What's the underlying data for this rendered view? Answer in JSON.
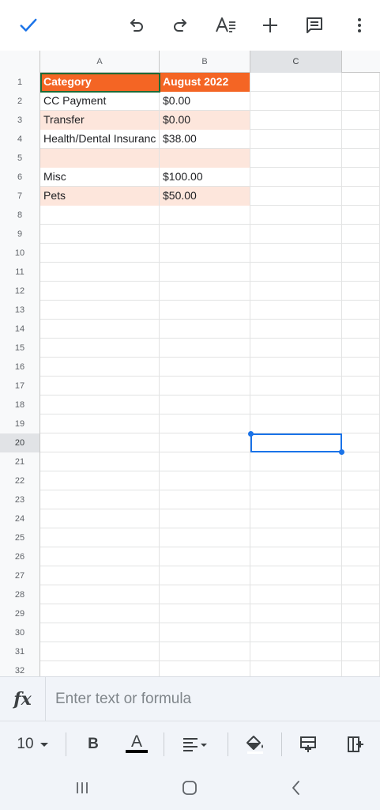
{
  "toolbar": {
    "done_icon": "check-icon",
    "undo_icon": "undo-icon",
    "redo_icon": "redo-icon",
    "text_format_icon": "text-format-icon",
    "insert_icon": "plus-icon",
    "comment_icon": "comment-icon",
    "more_icon": "more-vert-icon",
    "accent": "#1a73e8"
  },
  "columns": [
    "A",
    "B",
    "C"
  ],
  "rows": [
    {
      "num": "1",
      "a": "Category",
      "b": "August 2022",
      "style": "header"
    },
    {
      "num": "2",
      "a": "CC Payment",
      "b": "$0.00",
      "style": "plain"
    },
    {
      "num": "3",
      "a": "Transfer",
      "b": "$0.00",
      "style": "band"
    },
    {
      "num": "4",
      "a": "Health/Dental Insuranc",
      "b": "$38.00",
      "style": "plain"
    },
    {
      "num": "5",
      "a": "",
      "b": "",
      "style": "band"
    },
    {
      "num": "6",
      "a": "Misc",
      "b": "$100.00",
      "style": "plain"
    },
    {
      "num": "7",
      "a": "Pets",
      "b": "$50.00",
      "style": "band"
    },
    {
      "num": "8",
      "a": "",
      "b": "",
      "style": "empty"
    },
    {
      "num": "9",
      "a": "",
      "b": "",
      "style": "empty"
    },
    {
      "num": "10",
      "a": "",
      "b": "",
      "style": "empty"
    },
    {
      "num": "11",
      "a": "",
      "b": "",
      "style": "empty"
    },
    {
      "num": "12",
      "a": "",
      "b": "",
      "style": "empty"
    },
    {
      "num": "13",
      "a": "",
      "b": "",
      "style": "empty"
    },
    {
      "num": "14",
      "a": "",
      "b": "",
      "style": "empty"
    },
    {
      "num": "15",
      "a": "",
      "b": "",
      "style": "empty"
    },
    {
      "num": "16",
      "a": "",
      "b": "",
      "style": "empty"
    },
    {
      "num": "17",
      "a": "",
      "b": "",
      "style": "empty"
    },
    {
      "num": "18",
      "a": "",
      "b": "",
      "style": "empty"
    },
    {
      "num": "19",
      "a": "",
      "b": "",
      "style": "empty"
    },
    {
      "num": "20",
      "a": "",
      "b": "",
      "style": "empty"
    },
    {
      "num": "21",
      "a": "",
      "b": "",
      "style": "empty"
    },
    {
      "num": "22",
      "a": "",
      "b": "",
      "style": "empty"
    },
    {
      "num": "23",
      "a": "",
      "b": "",
      "style": "empty"
    },
    {
      "num": "24",
      "a": "",
      "b": "",
      "style": "empty"
    },
    {
      "num": "25",
      "a": "",
      "b": "",
      "style": "empty"
    },
    {
      "num": "26",
      "a": "",
      "b": "",
      "style": "empty"
    },
    {
      "num": "27",
      "a": "",
      "b": "",
      "style": "empty"
    },
    {
      "num": "28",
      "a": "",
      "b": "",
      "style": "empty"
    },
    {
      "num": "29",
      "a": "",
      "b": "",
      "style": "empty"
    },
    {
      "num": "30",
      "a": "",
      "b": "",
      "style": "empty"
    },
    {
      "num": "31",
      "a": "",
      "b": "",
      "style": "empty"
    },
    {
      "num": "32",
      "a": "",
      "b": "",
      "style": "empty"
    }
  ],
  "selection": {
    "cell": "C20",
    "column": "C",
    "row": "20"
  },
  "formula_bar": {
    "fx_label": "fx",
    "placeholder": "Enter text or formula"
  },
  "format_bar": {
    "font_size": "10",
    "bold_label": "B",
    "text_color_label": "A",
    "align_icon": "align-left-icon",
    "fill_icon": "fill-color-icon",
    "insert_row_icon": "insert-row-icon",
    "insert_col_icon": "insert-column-icon"
  },
  "nav": {
    "recents_icon": "recents-icon",
    "home_icon": "home-icon",
    "back_icon": "back-icon"
  },
  "colors": {
    "header_fill": "#f46524",
    "band_fill": "#fde6dc",
    "selection": "#1a73e8",
    "a1_border": "#1e6b37"
  }
}
